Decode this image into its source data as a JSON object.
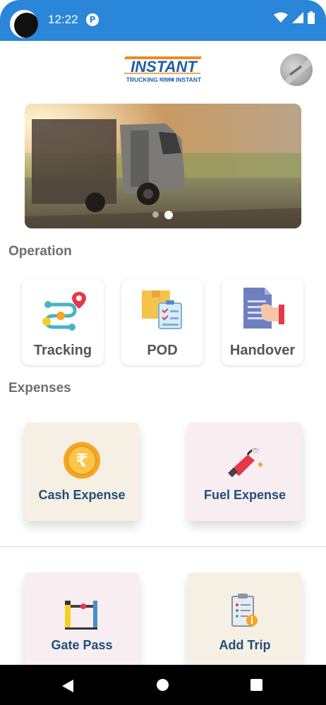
{
  "status_bar": {
    "time": "12:22",
    "notification_icon": "pocket-icon",
    "icons": [
      "wifi-icon",
      "signal-icon",
      "battery-icon"
    ]
  },
  "header": {
    "logo_text": "INSTANT",
    "logo_tagline": "TRUCKING मतलब INSTANT",
    "logo_color": "#1f5fa8",
    "logo_accent": "#f28a1c"
  },
  "banner": {
    "image": "truck-on-highway",
    "slide_count": 2,
    "active_slide": 2
  },
  "operation": {
    "title": "Operation",
    "items": [
      {
        "label": "Tracking",
        "icon": "route-pin-icon"
      },
      {
        "label": "POD",
        "icon": "box-checklist-icon"
      },
      {
        "label": "Handover",
        "icon": "document-hand-icon"
      }
    ]
  },
  "expenses": {
    "title": "Expenses",
    "items": [
      {
        "label": "Cash Expense",
        "icon": "rupee-coin-icon"
      },
      {
        "label": "Fuel Expense",
        "icon": "fuel-nozzle-icon"
      },
      {
        "label": "Gate Pass",
        "icon": "barrier-gate-icon"
      },
      {
        "label": "Add Trip",
        "icon": "clipboard-info-icon"
      }
    ]
  },
  "colors": {
    "status_bar": "#2a86d9",
    "card_label": "#1f4f7a",
    "section_title": "#6e6e6e",
    "card_beige": "#f6efe4",
    "card_pink": "#f8edf1"
  }
}
